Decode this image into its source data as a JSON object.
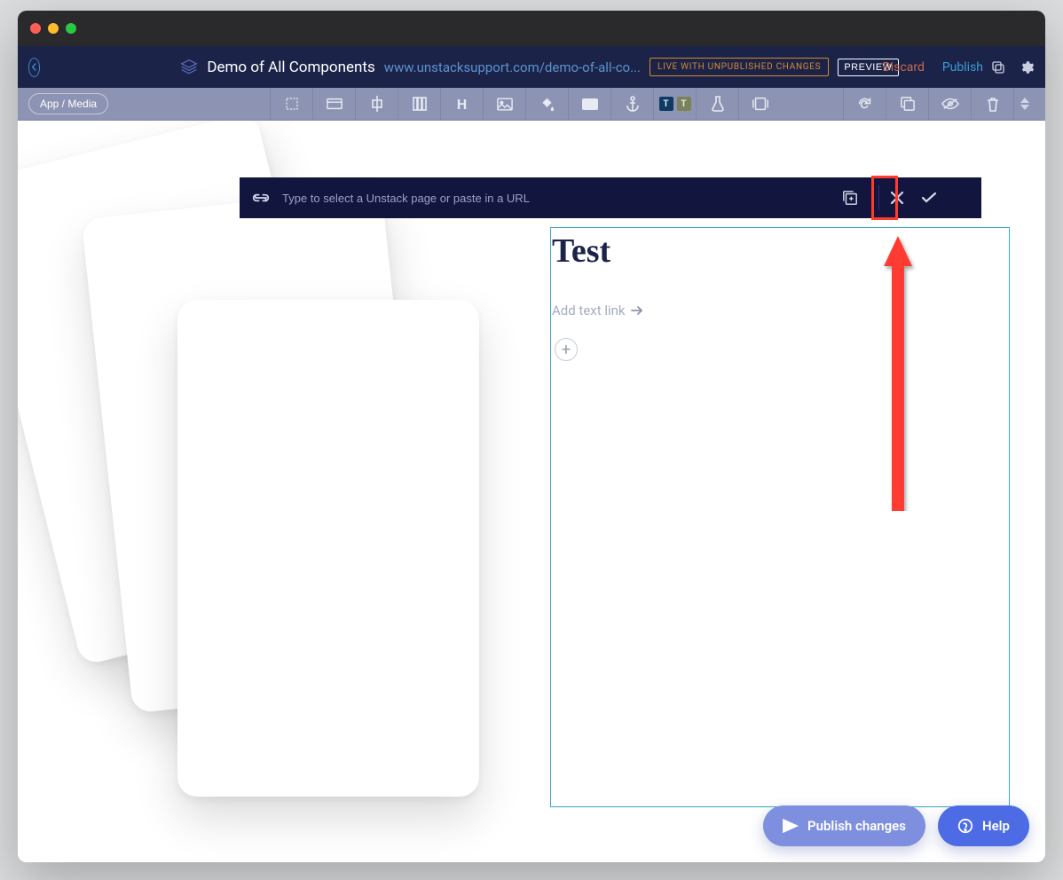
{
  "header": {
    "page_title": "Demo of All Components",
    "page_url": "www.unstacksupport.com/demo-of-all-co...",
    "live_badge": "LIVE WITH UNPUBLISHED CHANGES",
    "preview_label": "PREVIEW",
    "discard_label": "Discard",
    "publish_label": "Publish"
  },
  "toolbar": {
    "pill_label": "App / Media"
  },
  "linkbar": {
    "placeholder": "Type to select a Unstack page or paste in a URL"
  },
  "pane": {
    "heading": "Test",
    "add_text_link": "Add text link"
  },
  "fabs": {
    "publish_changes": "Publish changes",
    "help": "Help"
  }
}
